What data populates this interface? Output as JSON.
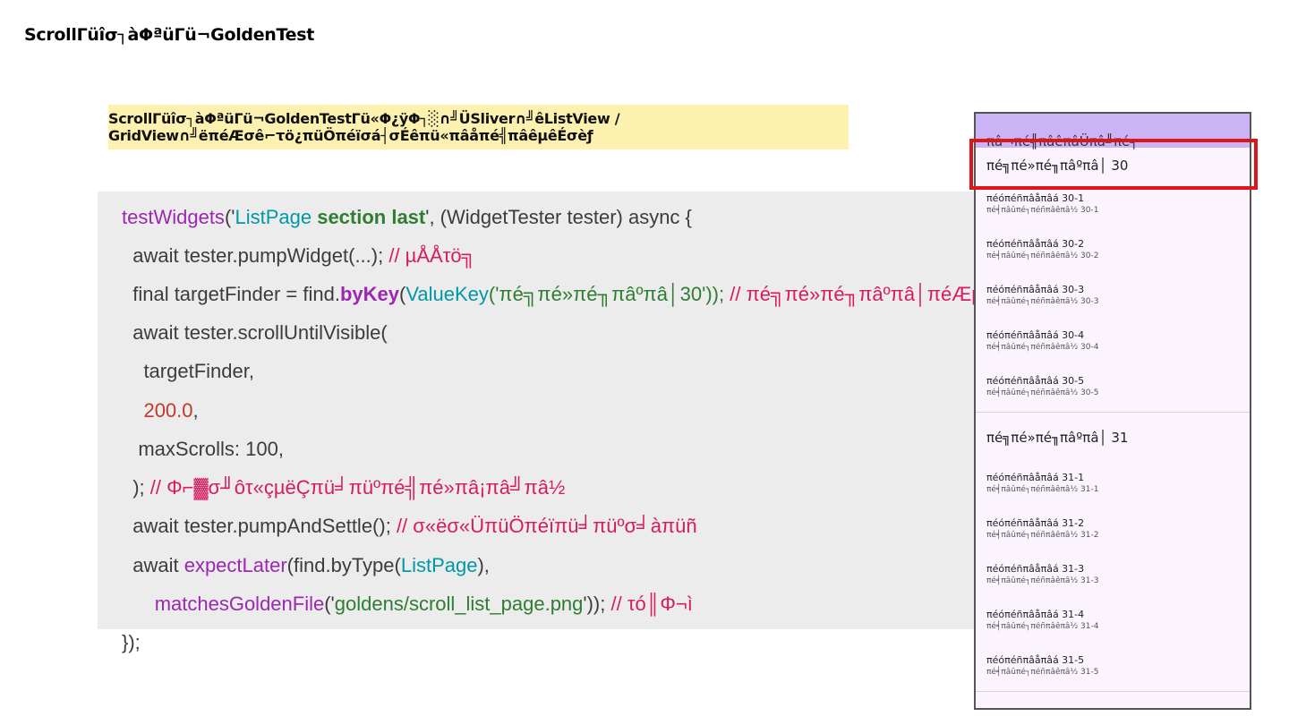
{
  "slide": {
    "title": "ScrollΓüîσ┐àΦªüΓü¬GoldenTest"
  },
  "banner": {
    "text": "ScrollΓüîσ┐àΦªüΓü¬GoldenTestΓü«Φ¿ÿΦ┐░∩╝ÜSliver∩╝êListView / GridView∩╝ëπéÆσê⌐τö¿πüÖπéïσá┤σÉêπü«πâåπé╣πâêµêÉσèƒ"
  },
  "code": {
    "l1": [
      "testWidgets",
      "('",
      "ListPage ",
      "section last",
      "', (WidgetTester tester) async {"
    ],
    "l2": [
      "  await tester.pumpWidget(...); ",
      "// µÅÅτö╗"
    ],
    "l3": [
      "  final targetFinder = find.",
      "byKey",
      "(",
      "ValueKey",
      "('πé╗πé»πé╖πâºπâ│30')); ",
      "// πé╗πé»πé╖πâºπâ│πéÆµÄóπüÖ"
    ],
    "l4": [
      "  await tester.scrollUntilVisible("
    ],
    "l5": [
      "    targetFinder,"
    ],
    "l6": [
      "    ",
      "200.0",
      ","
    ],
    "l7": [
      "   maxScrolls: 100,"
    ],
    "l8": [
      "  ); ",
      "// Φ⌐▓σ╜ôτ«çµëÇπü╛πüºπé╣πé»πâ¡πâ╝πâ½"
    ],
    "l9": [
      "  await tester.pumpAndSettle(); ",
      "// σ«ëσ«ÜπüÖπéïπü╛πüºσ╛àπüñ"
    ],
    "l10": [
      "  await ",
      "expectLater",
      "(find.byType(",
      "ListPage",
      "),"
    ],
    "l11": [
      "      ",
      "matchesGoldenFile",
      "('",
      "goldens/scroll_list_page.png",
      "')); ",
      "// τó║Φ¬ì"
    ],
    "l12": [
      "});"
    ]
  },
  "phone": {
    "appbar_title": "πâ¬πé╣πâêπâÜπâ╝πé╕",
    "sections": [
      {
        "header": "πé╗πé»πé╖πâºπâ│ 30",
        "items": [
          {
            "title": "πéóπéñπâåπâá 30-1",
            "subtitle": "πé╡πâûπé┐πéñπâêπâ½ 30-1"
          },
          {
            "title": "πéóπéñπâåπâá 30-2",
            "subtitle": "πé╡πâûπé┐πéñπâêπâ½ 30-2"
          },
          {
            "title": "πéóπéñπâåπâá 30-3",
            "subtitle": "πé╡πâûπé┐πéñπâêπâ½ 30-3"
          },
          {
            "title": "πéóπéñπâåπâá 30-4",
            "subtitle": "πé╡πâûπé┐πéñπâêπâ½ 30-4"
          },
          {
            "title": "πéóπéñπâåπâá 30-5",
            "subtitle": "πé╡πâûπé┐πéñπâêπâ½ 30-5"
          }
        ]
      },
      {
        "header": "πé╗πé»πé╖πâºπâ│ 31",
        "items": [
          {
            "title": "πéóπéñπâåπâá 31-1",
            "subtitle": "πé╡πâûπé┐πéñπâêπâ½ 31-1"
          },
          {
            "title": "πéóπéñπâåπâá 31-2",
            "subtitle": "πé╡πâûπé┐πéñπâêπâ½ 31-2"
          },
          {
            "title": "πéóπéñπâåπâá 31-3",
            "subtitle": "πé╡πâûπé┐πéñπâêπâ½ 31-3"
          },
          {
            "title": "πéóπéñπâåπâá 31-4",
            "subtitle": "πé╡πâûπé┐πéñπâêπâ½ 31-4"
          },
          {
            "title": "πéóπéñπâåπâá 31-5",
            "subtitle": "πé╡πâûπé┐πéñπâêπâ½ 31-5"
          }
        ]
      }
    ]
  },
  "colors": {
    "banner_bg": "#fdf1b0",
    "code_bg": "#ececec",
    "appbar": "#cbb4f5",
    "highlight": "#e0141b",
    "keyword_purple": "#9c27b0",
    "type_teal": "#0097a7",
    "string_green": "#2e7d32",
    "number_orange": "#c0392b",
    "comment_pink": "#d81b60"
  }
}
